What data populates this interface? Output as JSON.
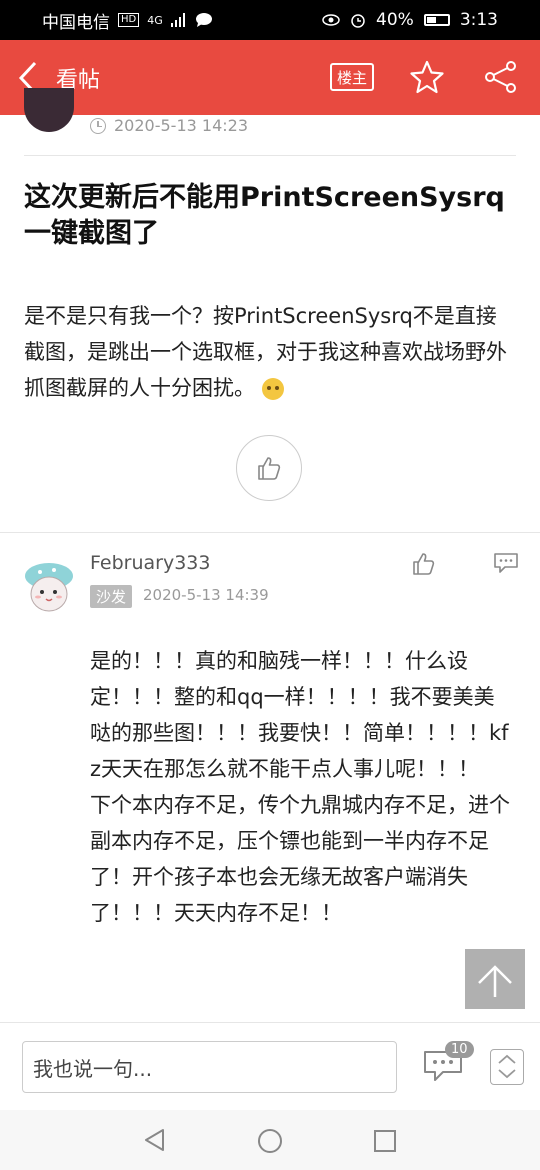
{
  "status_bar": {
    "carrier": "中国电信",
    "network": "4G",
    "battery": "40%",
    "time": "3:13"
  },
  "header": {
    "back_label": "看帖",
    "owner_label": "楼主"
  },
  "post": {
    "time": "2020-5-13 14:23",
    "title": "这次更新后不能用PrintScreenSysrq一键截图了",
    "body": "是不是只有我一个？按PrintScreenSysrq不是直接截图，是跳出一个选取框，对于我这种喜欢战场野外抓图截屏的人十分困扰。"
  },
  "reply": {
    "username": "February333",
    "badge": "沙发",
    "time": "2020-5-13 14:39",
    "paragraph1": "是的！！！真的和脑残一样！！！什么设定！！！整的和qq一样！！！！我不要美美哒的那些图！！！我要快！！简单！！！！kfz天天在那怎么就不能干点人事儿呢！！！",
    "paragraph2": "下个本内存不足，传个九鼎城内存不足，进个副本内存不足，压个镖也能到一半内存不足了！开个孩子本也会无缘无故客户端消失了！！！天天内存不足！！"
  },
  "input_bar": {
    "placeholder": "我也说一句...",
    "comment_count": "10"
  },
  "colors": {
    "header": "#e84a40",
    "accent_text": "#ffffff"
  }
}
